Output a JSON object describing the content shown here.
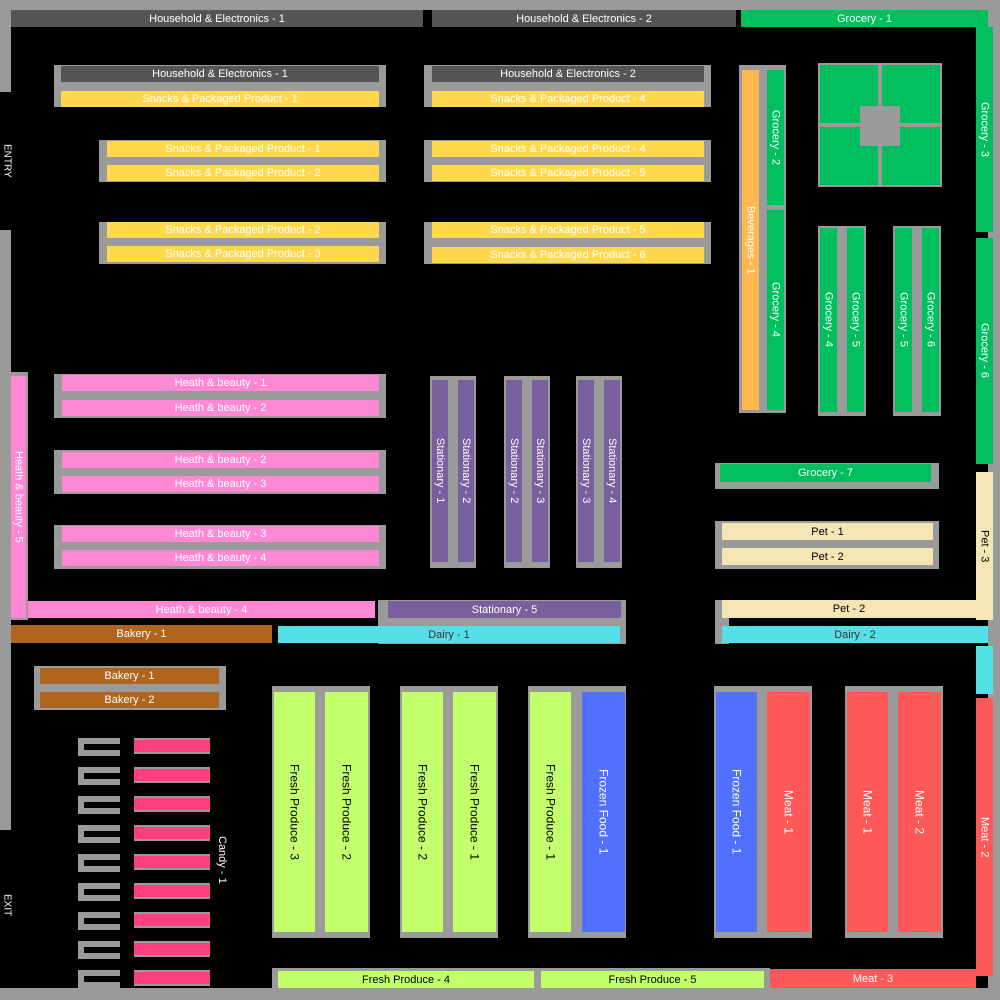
{
  "labels": {
    "entry": "ENTRY",
    "exit": "EXIT",
    "he1": "Household & Electronics - 1",
    "he2": "Household & Electronics - 2",
    "sp1": "Snacks & Packaged Product  - 1",
    "sp2": "Snacks & Packaged Product  - 2",
    "sp3": "Snacks & Packaged Product  - 3",
    "sp4": "Snacks & Packaged Product  - 4",
    "sp5": "Snacks & Packaged Product  - 5",
    "sp6": "Snacks & Packaged Product  - 6",
    "hb1": "Heath & beauty - 1",
    "hb2": "Heath & beauty - 2",
    "hb3": "Heath & beauty - 3",
    "hb4": "Heath & beauty - 4",
    "hb5": "Heath & beauty - 5",
    "st1": "Stationary - 1",
    "st2": "Stationary - 2",
    "st3": "Stationary - 3",
    "st4": "Stationary - 4",
    "st5": "Stationary - 5",
    "gr1": "Grocery - 1",
    "gr2": "Grocery - 2",
    "gr3": "Grocery - 3",
    "gr4": "Grocery - 4",
    "gr5": "Grocery - 5",
    "gr6": "Grocery - 6",
    "gr7": "Grocery - 7",
    "bev1": "Beverages - 1",
    "pet1": "Pet - 1",
    "pet2": "Pet - 2",
    "pet3": "Pet - 3",
    "bk1": "Bakery - 1",
    "bk2": "Bakery - 2",
    "da1": "Dairy - 1",
    "da2": "Dairy - 2",
    "fp1": "Fresh Produce - 1",
    "fp2": "Fresh Produce - 2",
    "fp3": "Fresh Produce - 3",
    "fp4": "Fresh Produce - 4",
    "fp5": "Fresh Produce - 5",
    "ff1": "Frozen Food - 1",
    "mt1": "Meat - 1",
    "mt2": "Meat - 2",
    "mt3": "Meat - 3",
    "candy1": "Candy - 1"
  },
  "colors": {
    "household": "#555555",
    "snacks": "#ffd84d",
    "health": "#ff88d5",
    "stationary": "#7a5f9e",
    "grocery": "#00bf5f",
    "beverages": "#ffb74f",
    "pet": "#f3e6b4",
    "bakery": "#b1641b",
    "dairy": "#55e0e8",
    "produce": "#c2ff6b",
    "frozen": "#5170ff",
    "meat": "#ff5858",
    "candy": "#ff3f7f",
    "fixture": "#9a9a9a"
  }
}
